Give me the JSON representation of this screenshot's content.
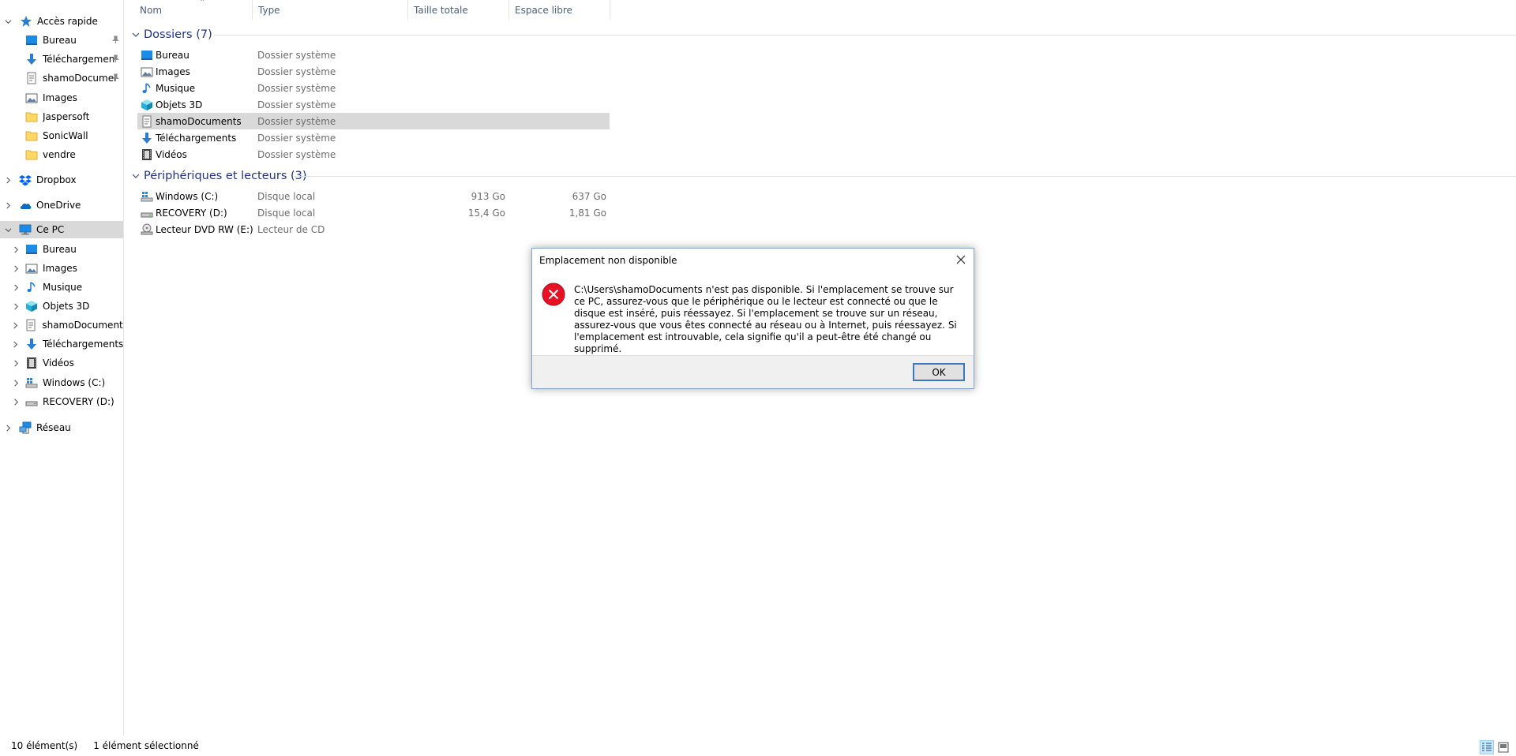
{
  "nav": {
    "quick_access": {
      "label": "Accès rapide",
      "icon": "star-icon"
    },
    "quick_items": [
      {
        "label": "Bureau",
        "icon": "desktop-icon",
        "pinned": true
      },
      {
        "label": "Téléchargements",
        "icon": "download-icon",
        "pinned": true
      },
      {
        "label": "shamoDocuments",
        "icon": "document-icon",
        "pinned": true
      },
      {
        "label": "Images",
        "icon": "images-icon",
        "pinned": false
      },
      {
        "label": "Jaspersoft",
        "icon": "folder-icon",
        "pinned": false
      },
      {
        "label": "SonicWall",
        "icon": "folder-icon",
        "pinned": false
      },
      {
        "label": "vendre",
        "icon": "folder-icon",
        "pinned": false
      }
    ],
    "dropbox": {
      "label": "Dropbox",
      "icon": "dropbox-icon"
    },
    "onedrive": {
      "label": "OneDrive",
      "icon": "cloud-icon"
    },
    "this_pc": {
      "label": "Ce PC",
      "icon": "computer-icon"
    },
    "pc_items": [
      {
        "label": "Bureau",
        "icon": "desktop-icon"
      },
      {
        "label": "Images",
        "icon": "images-icon"
      },
      {
        "label": "Musique",
        "icon": "music-icon"
      },
      {
        "label": "Objets 3D",
        "icon": "cube-icon"
      },
      {
        "label": "shamoDocuments",
        "icon": "document-icon"
      },
      {
        "label": "Téléchargements",
        "icon": "download-icon"
      },
      {
        "label": "Vidéos",
        "icon": "video-icon"
      },
      {
        "label": "Windows (C:)",
        "icon": "windows-drive-icon"
      },
      {
        "label": "RECOVERY (D:)",
        "icon": "drive-icon"
      }
    ],
    "network": {
      "label": "Réseau",
      "icon": "network-icon"
    }
  },
  "columns": {
    "name": "Nom",
    "type": "Type",
    "total": "Taille totale",
    "free": "Espace libre"
  },
  "groups": {
    "folders": {
      "title": "Dossiers (7)",
      "items": [
        {
          "name": "Bureau",
          "type": "Dossier système",
          "icon": "desktop-icon"
        },
        {
          "name": "Images",
          "type": "Dossier système",
          "icon": "images-icon"
        },
        {
          "name": "Musique",
          "type": "Dossier système",
          "icon": "music-icon"
        },
        {
          "name": "Objets 3D",
          "type": "Dossier système",
          "icon": "cube-icon"
        },
        {
          "name": "shamoDocuments",
          "type": "Dossier système",
          "icon": "document-icon"
        },
        {
          "name": "Téléchargements",
          "type": "Dossier système",
          "icon": "download-icon"
        },
        {
          "name": "Vidéos",
          "type": "Dossier système",
          "icon": "video-icon"
        }
      ]
    },
    "devices": {
      "title": "Périphériques et lecteurs (3)",
      "items": [
        {
          "name": "Windows (C:)",
          "type": "Disque local",
          "total": "913 Go",
          "free": "637 Go",
          "icon": "windows-drive-icon"
        },
        {
          "name": "RECOVERY (D:)",
          "type": "Disque local",
          "total": "15,4 Go",
          "free": "1,81 Go",
          "icon": "drive-icon"
        },
        {
          "name": "Lecteur DVD RW (E:)",
          "type": "Lecteur de CD",
          "total": "",
          "free": "",
          "icon": "dvd-drive-icon"
        }
      ]
    }
  },
  "status": {
    "count": "10 élément(s)",
    "selection": "1 élément sélectionné"
  },
  "dialog": {
    "title": "Emplacement non disponible",
    "message": "C:\\Users\\shamoDocuments n'est pas disponible. Si l'emplacement se trouve sur ce PC, assurez-vous que le périphérique ou le lecteur est connecté ou que le disque est inséré, puis réessayez. Si l'emplacement se trouve sur un réseau, assurez-vous que vous êtes connecté au réseau ou à Internet, puis réessayez. Si l'emplacement est introuvable, cela signifie qu'il a peut-être été changé ou supprimé.",
    "ok_label": "OK",
    "icon": "error-icon"
  },
  "colors": {
    "accent": "#1e3287",
    "selection": "#d9d9d9",
    "header_text": "#4c607a",
    "error": "#e81123"
  }
}
